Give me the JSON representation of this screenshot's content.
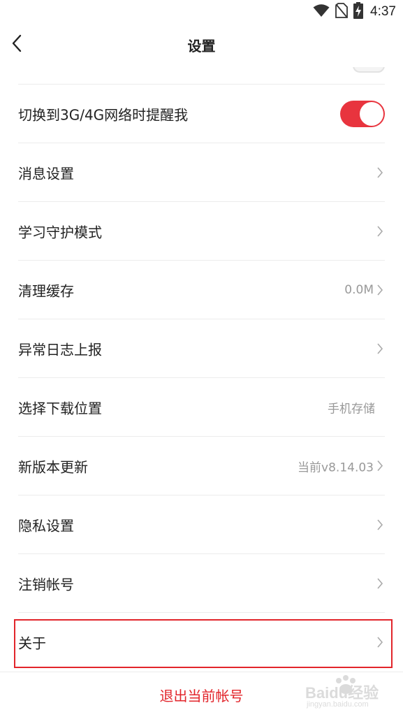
{
  "status_bar": {
    "time": "4:37",
    "icons": [
      "wifi-icon",
      "no-sim-icon",
      "battery-charging-icon"
    ]
  },
  "nav": {
    "title": "设置",
    "back_icon": "chevron-left-icon"
  },
  "settings": [
    {
      "id": "network-alert",
      "label": "切换到3G/4G网络时提醒我",
      "type": "toggle",
      "on": true
    },
    {
      "id": "message-settings",
      "label": "消息设置",
      "type": "chevron"
    },
    {
      "id": "study-guard",
      "label": "学习守护模式",
      "type": "chevron"
    },
    {
      "id": "clear-cache",
      "label": "清理缓存",
      "type": "value-chevron",
      "value": "0.0M"
    },
    {
      "id": "error-log",
      "label": "异常日志上报",
      "type": "chevron"
    },
    {
      "id": "download-location",
      "label": "选择下载位置",
      "type": "value",
      "value": "手机存储"
    },
    {
      "id": "version-update",
      "label": "新版本更新",
      "type": "value-chevron",
      "value": "当前v8.14.03"
    },
    {
      "id": "privacy",
      "label": "隐私设置",
      "type": "chevron"
    },
    {
      "id": "delete-account",
      "label": "注销帐号",
      "type": "chevron"
    },
    {
      "id": "about",
      "label": "关于",
      "type": "chevron"
    }
  ],
  "logout": {
    "label": "退出当前帐号"
  },
  "watermark": {
    "text": "Baidu经验",
    "sub": "jingyan.baidu.com"
  },
  "colors": {
    "accent": "#e8343e",
    "logout_text": "#e2252b",
    "highlight_border": "#e2252b",
    "secondary_text": "#999999"
  }
}
